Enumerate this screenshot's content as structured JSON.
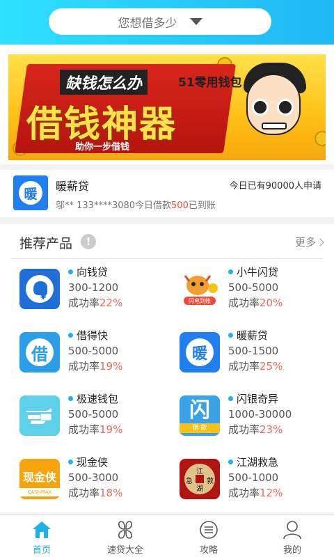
{
  "header": {
    "amount_prompt": "您想借多少",
    "accent": "#1fb8f5"
  },
  "banner": {
    "slogan_left": "缺钱怎么办",
    "slogan_right": "51零用钱包",
    "headline": "借钱神器",
    "sub": "助你一步借钱"
  },
  "notice": {
    "logo_char": "暖",
    "name": "暖薪贷",
    "applicants": "今日已有90000人申请",
    "record_prefix": "邬** 133****3080今日借款",
    "record_amount": "500",
    "record_suffix": "已到账"
  },
  "section": {
    "title": "推荐产品",
    "info_icon": "!",
    "more": "更多"
  },
  "products": [
    {
      "name": "向钱贷",
      "range": "300-1200",
      "rate_label": "成功率",
      "rate": "22%",
      "icon": "elephant-yen-icon"
    },
    {
      "name": "小牛闪贷",
      "range": "500-5000",
      "rate_label": "成功率",
      "rate": "20%",
      "icon": "cartoon-calf-icon",
      "icon_caption": "闪电到账"
    },
    {
      "name": "借得快",
      "range": "500-5000",
      "rate_label": "成功率",
      "rate": "19%",
      "icon": "jie-character-icon",
      "icon_char": "借"
    },
    {
      "name": "暖薪贷",
      "range": "500-1500",
      "rate_label": "成功率",
      "rate": "25%",
      "icon": "nuan-character-icon",
      "icon_char": "暖"
    },
    {
      "name": "极速钱包",
      "range": "500-5000",
      "rate_label": "成功率",
      "rate": "19%",
      "icon": "winged-wallet-icon"
    },
    {
      "name": "闪银奇异",
      "range": "1000-30000",
      "rate_label": "成功率",
      "rate": "23%",
      "icon": "shan-character-icon",
      "icon_char": "闪",
      "icon_caption": "借 款"
    },
    {
      "name": "现金侠",
      "range": "500-3000",
      "rate_label": "成功率",
      "rate": "18%",
      "icon": "cashmax-icon",
      "icon_char": "现金侠",
      "icon_caption": "CASHMAX"
    },
    {
      "name": "江湖救急",
      "range": "500-1000",
      "rate_label": "成功率",
      "rate": "12%",
      "icon": "jianghu-seal-icon",
      "icon_chars": [
        "江",
        "急",
        "救",
        "湖"
      ]
    }
  ],
  "tabbar": [
    {
      "label": "首页",
      "icon": "home-icon",
      "active": true
    },
    {
      "label": "速贷大全",
      "icon": "clover-icon",
      "active": false
    },
    {
      "label": "攻略",
      "icon": "chat-list-icon",
      "active": false
    },
    {
      "label": "我的",
      "icon": "person-icon",
      "active": false
    }
  ]
}
